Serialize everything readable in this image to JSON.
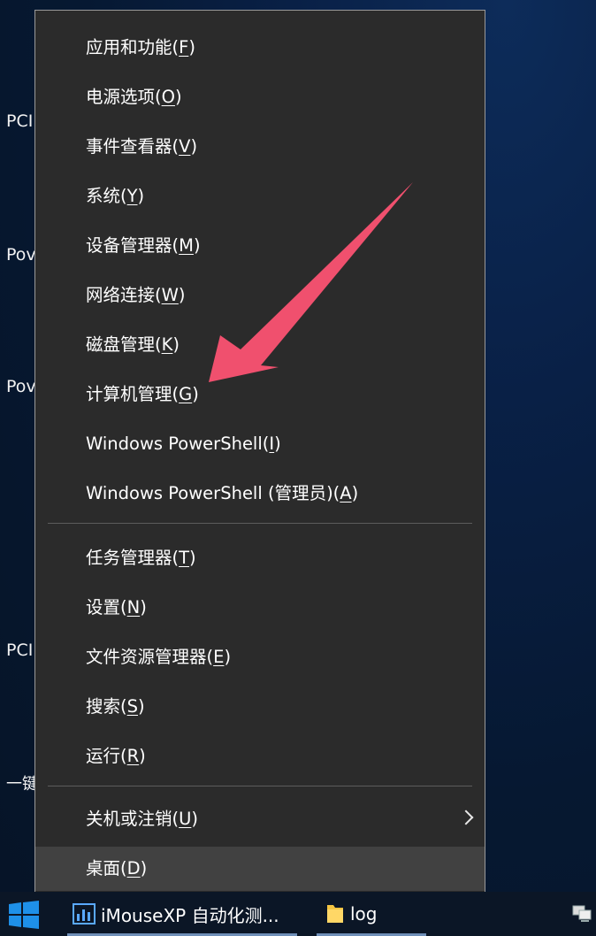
{
  "desktop": {
    "fragments": [
      "PCI",
      "Pov",
      "Pov",
      "PCI",
      "一键"
    ]
  },
  "menu": {
    "items": [
      {
        "label": "应用和功能(",
        "key": "F",
        "close": ")"
      },
      {
        "label": "电源选项(",
        "key": "O",
        "close": ")"
      },
      {
        "label": "事件查看器(",
        "key": "V",
        "close": ")"
      },
      {
        "label": "系统(",
        "key": "Y",
        "close": ")"
      },
      {
        "label": "设备管理器(",
        "key": "M",
        "close": ")"
      },
      {
        "label": "网络连接(",
        "key": "W",
        "close": ")"
      },
      {
        "label": "磁盘管理(",
        "key": "K",
        "close": ")"
      },
      {
        "label": "计算机管理(",
        "key": "G",
        "close": ")"
      },
      {
        "label": "Windows PowerShell(",
        "key": "I",
        "close": ")"
      },
      {
        "label": "Windows PowerShell (管理员)(",
        "key": "A",
        "close": ")"
      },
      {
        "label": "任务管理器(",
        "key": "T",
        "close": ")"
      },
      {
        "label": "设置(",
        "key": "N",
        "close": ")"
      },
      {
        "label": "文件资源管理器(",
        "key": "E",
        "close": ")"
      },
      {
        "label": "搜索(",
        "key": "S",
        "close": ")"
      },
      {
        "label": "运行(",
        "key": "R",
        "close": ")"
      },
      {
        "label": "关机或注销(",
        "key": "U",
        "close": ")"
      },
      {
        "label": "桌面(",
        "key": "D",
        "close": ")"
      }
    ]
  },
  "taskbar": {
    "apps": [
      {
        "label": "iMouseXP 自动化测..."
      },
      {
        "label": "log"
      }
    ]
  },
  "colors": {
    "menu_bg": "#2b2b2b",
    "menu_hover": "#414141",
    "arrow": "#f0506e",
    "taskbar_bg": "#0b1626",
    "windows_blue": "#1e90e8"
  },
  "icons": {
    "start": "windows-logo-icon",
    "imouse": "chart-app-icon",
    "log": "folder-icon",
    "tray": "network-icon",
    "submenu": "chevron-right-icon",
    "annotation": "red-arrow-icon"
  }
}
